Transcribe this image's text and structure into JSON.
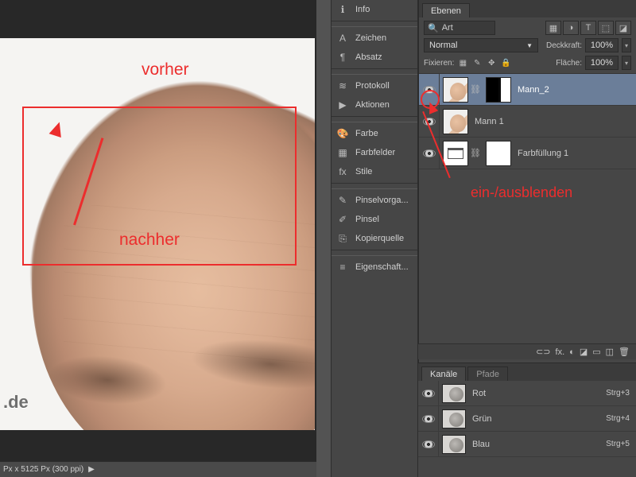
{
  "canvas": {
    "anno_vorher": "vorher",
    "anno_nachher": "nachher",
    "watermark": ".de",
    "status_dims": "Px x 5125 Px (300 ppi)",
    "status_arrow": "▶"
  },
  "panels": [
    {
      "icon": "ℹ",
      "label": "Info"
    },
    {
      "sep": true
    },
    {
      "icon": "A",
      "label": "Zeichen"
    },
    {
      "icon": "¶",
      "label": "Absatz"
    },
    {
      "sep": true
    },
    {
      "icon": "≋",
      "label": "Protokoll"
    },
    {
      "icon": "▶",
      "label": "Aktionen"
    },
    {
      "sep": true
    },
    {
      "icon": "🎨",
      "label": "Farbe"
    },
    {
      "icon": "▦",
      "label": "Farbfelder"
    },
    {
      "icon": "fx",
      "label": "Stile"
    },
    {
      "sep": true
    },
    {
      "icon": "✎",
      "label": "Pinselvorga..."
    },
    {
      "icon": "✐",
      "label": "Pinsel"
    },
    {
      "icon": "⎘",
      "label": "Kopierquelle"
    },
    {
      "sep": true
    },
    {
      "icon": "≡",
      "label": "Eigenschaft..."
    }
  ],
  "layers": {
    "tab": "Ebenen",
    "search_icon": "🔍",
    "search_kind": "Art",
    "filter_icons": [
      "▦",
      "◑",
      "T",
      "⬚",
      "◪"
    ],
    "blend_mode": "Normal",
    "opacity_label": "Deckkraft:",
    "opacity_value": "100%",
    "lock_label": "Fixieren:",
    "fill_label": "Fläche:",
    "fill_value": "100%",
    "lock_icons": [
      "▦",
      "✎",
      "✥",
      "🔒"
    ],
    "rows": [
      {
        "name": "Mann_2",
        "selected": true,
        "mask": true
      },
      {
        "name": "Mann 1",
        "selected": false,
        "mask": false
      },
      {
        "name": "Farbfüllung 1",
        "selected": false,
        "mask": false,
        "adj": true
      }
    ],
    "anno": "ein-/ausblenden",
    "footer": [
      "⊂⊃",
      "fx.",
      "◐",
      "◪",
      "▭",
      "◫",
      "🗑"
    ]
  },
  "channels": {
    "tab_active": "Kanäle",
    "tab_inactive": "Pfade",
    "rows": [
      {
        "name": "Rot",
        "sc": "Strg+3"
      },
      {
        "name": "Grün",
        "sc": "Strg+4"
      },
      {
        "name": "Blau",
        "sc": "Strg+5"
      }
    ]
  }
}
